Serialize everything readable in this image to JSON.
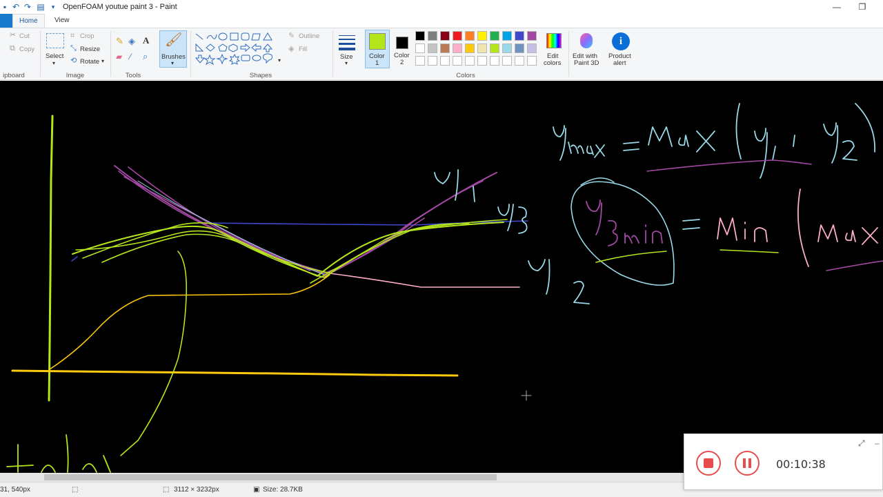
{
  "window": {
    "title": "OpenFOAM youtue paint 3 - Paint",
    "minimize": "—",
    "restore": "❐"
  },
  "tabs": [
    "Home",
    "View"
  ],
  "ribbon": {
    "clipboard": {
      "cut": "Cut",
      "copy": "Copy",
      "label": "ipboard"
    },
    "image": {
      "select": "Select",
      "crop": "Crop",
      "resize": "Resize",
      "rotate": "Rotate",
      "label": "Image"
    },
    "tools": {
      "label": "Tools"
    },
    "brushes": {
      "label": "Brushes"
    },
    "shapes": {
      "outline": "Outline",
      "fill": "Fill",
      "label": "Shapes"
    },
    "size": {
      "label": "Size"
    },
    "color1": {
      "line1": "Color",
      "line2": "1",
      "value": "#b5e61d"
    },
    "color2": {
      "line1": "Color",
      "line2": "2",
      "value": "#000000"
    },
    "colors": {
      "label": "Colors",
      "row1": [
        "#000000",
        "#7f7f7f",
        "#880015",
        "#ed1c24",
        "#ff7f27",
        "#fff200",
        "#22b14c",
        "#00a2e8",
        "#3f48cc",
        "#a349a4"
      ],
      "row2": [
        "#ffffff",
        "#c3c3c3",
        "#b97a57",
        "#ffaec9",
        "#ffc90e",
        "#efe4b0",
        "#b5e61d",
        "#99d9ea",
        "#7092be",
        "#c8bfe7"
      ],
      "row3": [
        "#ffffff",
        "#ffffff",
        "#ffffff",
        "#ffffff",
        "#ffffff",
        "#ffffff",
        "#ffffff",
        "#ffffff",
        "#ffffff",
        "#ffffff"
      ]
    },
    "edit_colors": {
      "line1": "Edit",
      "line2": "colors"
    },
    "paint3d": {
      "line1": "Edit with",
      "line2": "Paint 3D"
    },
    "product_alert": {
      "line1": "Product",
      "line2": "alert"
    }
  },
  "statusbar": {
    "cursor_pos": "31, 540px",
    "image_size": "3112 × 3232px",
    "file_size": "Size: 28.7KB"
  },
  "recorder": {
    "time": "00:10:38"
  },
  "ink": {
    "green": "#b5e61d",
    "yellow": "#ffc90e",
    "magenta": "#a349a4",
    "blue": "#3f48cc",
    "cyan": "#99d9ea",
    "pink": "#ffaec9"
  }
}
